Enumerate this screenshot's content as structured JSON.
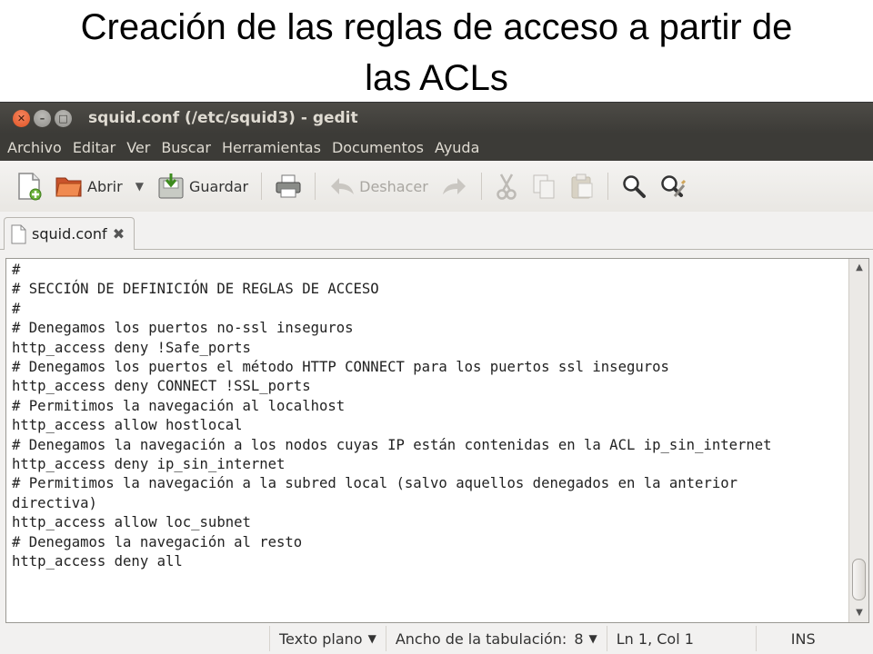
{
  "slide": {
    "title_line1": "Creación de las reglas de acceso a partir de",
    "title_line2": "las ACLs"
  },
  "window": {
    "title": "squid.conf (/etc/squid3) - gedit"
  },
  "menu": [
    "Archivo",
    "Editar",
    "Ver",
    "Buscar",
    "Herramientas",
    "Documentos",
    "Ayuda"
  ],
  "toolbar": {
    "open_label": "Abrir",
    "save_label": "Guardar",
    "undo_label": "Deshacer"
  },
  "tab": {
    "label": "squid.conf"
  },
  "editor": {
    "lines": [
      "#",
      "# SECCIÓN DE DEFINICIÓN DE REGLAS DE ACCESO",
      "#",
      "# Denegamos los puertos no-ssl inseguros",
      "http_access deny !Safe_ports",
      "# Denegamos los puertos el método HTTP CONNECT para los puertos ssl inseguros",
      "http_access deny CONNECT !SSL_ports",
      "# Permitimos la navegación al localhost",
      "http_access allow hostlocal",
      "# Denegamos la navegación a los nodos cuyas IP están contenidas en la ACL ip_sin_internet",
      "http_access deny ip_sin_internet",
      "# Permitimos la navegación a la subred local (salvo aquellos denegados en la anterior",
      "directiva)",
      "http_access allow loc_subnet",
      "# Denegamos la navegación al resto",
      "http_access deny all"
    ]
  },
  "statusbar": {
    "language": "Texto plano",
    "tab_width_label": "Ancho de la tabulación:",
    "tab_width_value": "8",
    "position": "Ln 1, Col 1",
    "mode": "INS"
  }
}
